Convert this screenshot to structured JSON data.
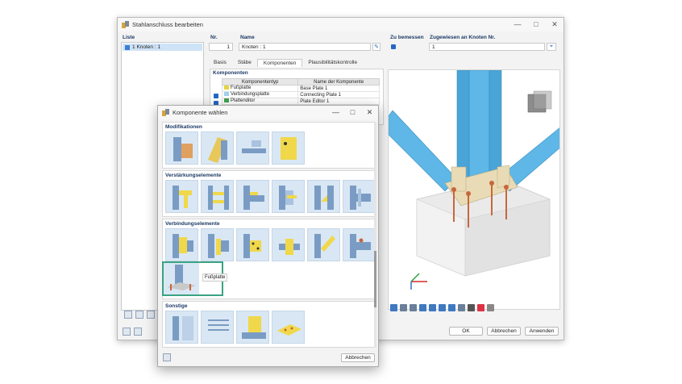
{
  "main_window": {
    "title": "Stahlanschluss bearbeiten",
    "controls": {
      "minimize": "—",
      "maximize": "□",
      "close": "✕"
    },
    "list_label": "Liste",
    "list_items": [
      {
        "number": "1",
        "label": "Knoten : 1"
      }
    ],
    "nr_label": "Nr.",
    "nr_value": "1",
    "name_label": "Name",
    "name_value": "Knoten : 1",
    "zu_bemessen_label": "Zu bemessen",
    "assigned_label": "Zugewiesen an Knoten Nr.",
    "assigned_value": "1",
    "tabs": [
      "Basis",
      "Stäbe",
      "Komponenten",
      "Plausibilitätskontrolle"
    ],
    "active_tab": "Komponenten",
    "components_header": "Komponenten",
    "table_headers": [
      "Komponententyp",
      "Name der Komponente"
    ],
    "table_rows": [
      {
        "type": "Fußplatte",
        "name": "Base Plate 1",
        "color": "#e8d43a"
      },
      {
        "type": "Verbindungsplatte",
        "name": "Connecting Plate 1",
        "color": "#9fd0ef"
      },
      {
        "type": "Plattenditor",
        "name": "Plate Editor 1",
        "color": "#3fa34d"
      }
    ],
    "buttons": {
      "ok": "OK",
      "cancel": "Abbrechen",
      "apply": "Anwenden"
    }
  },
  "dialog": {
    "title": "Komponente wählen",
    "controls": {
      "minimize": "—",
      "maximize": "□",
      "close": "✕"
    },
    "sections": {
      "modifications": "Modifikationen",
      "stiffeners": "Verstärkungselemente",
      "connection": "Verbindungselemente",
      "other": "Sonstige"
    },
    "selected_tooltip": "Fußplatte",
    "cancel_button": "Abbrechen"
  },
  "colors": {
    "accent_blue": "#2767c4",
    "member_blue": "#5eb7e6",
    "plate_beige": "#e8dbb6",
    "selection_green": "#3aa383",
    "anchor_orange": "#c8673a",
    "tile_bg": "#d9e7f4"
  }
}
